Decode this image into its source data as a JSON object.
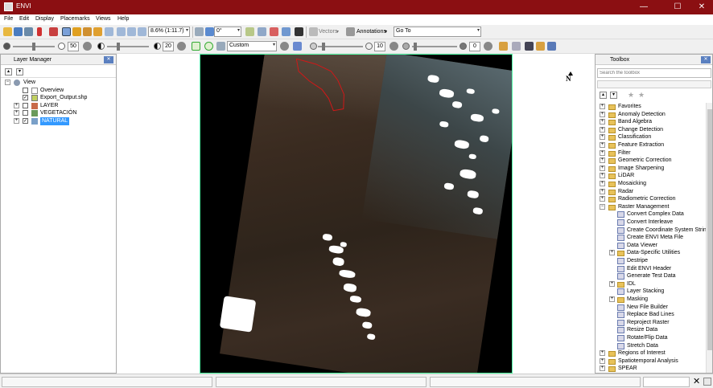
{
  "window": {
    "title": "ENVI",
    "minimize": "—",
    "maximize": "☐",
    "close": "✕"
  },
  "menu": [
    "File",
    "Edit",
    "Display",
    "Placemarks",
    "Views",
    "Help"
  ],
  "toolbar1": {
    "zoom_value": "8.6% (1:11.7)",
    "rotation_value": "0°",
    "vectors_label": "Vectors",
    "annotations_label": "Annotations",
    "goto_value": "Go To"
  },
  "toolbar2": {
    "brightness_value": "50",
    "contrast_value": "20",
    "stretch_value": "Custom",
    "sharpen_value": "10",
    "transparency_value": "0"
  },
  "layer_manager": {
    "title": "Layer Manager",
    "items": [
      {
        "label": "View"
      },
      {
        "label": "Overview"
      },
      {
        "label": "Export_Output.shp"
      },
      {
        "label": "LAYER"
      },
      {
        "label": "VEGETACIÓN"
      },
      {
        "label": "NATURAL"
      }
    ]
  },
  "north_arrow_label": "N",
  "toolbox": {
    "title": "Toolbox",
    "search_placeholder": "Search the toolbox",
    "items": [
      {
        "label": "Favorites",
        "kind": "folder"
      },
      {
        "label": "Anomaly Detection",
        "kind": "folder"
      },
      {
        "label": "Band Algebra",
        "kind": "folder"
      },
      {
        "label": "Change Detection",
        "kind": "folder"
      },
      {
        "label": "Classification",
        "kind": "folder"
      },
      {
        "label": "Feature Extraction",
        "kind": "folder"
      },
      {
        "label": "Filter",
        "kind": "folder"
      },
      {
        "label": "Geometric Correction",
        "kind": "folder"
      },
      {
        "label": "Image Sharpening",
        "kind": "folder"
      },
      {
        "label": "LiDAR",
        "kind": "folder"
      },
      {
        "label": "Mosaicking",
        "kind": "folder"
      },
      {
        "label": "Radar",
        "kind": "folder"
      },
      {
        "label": "Radiometric Correction",
        "kind": "folder"
      },
      {
        "label": "Raster Management",
        "kind": "folder-open"
      },
      {
        "label": "Convert Complex Data",
        "kind": "tool"
      },
      {
        "label": "Convert Interleave",
        "kind": "tool"
      },
      {
        "label": "Create Coordinate System String",
        "kind": "tool"
      },
      {
        "label": "Create ENVI Meta File",
        "kind": "tool"
      },
      {
        "label": "Data Viewer",
        "kind": "tool"
      },
      {
        "label": "Data-Specific Utilities",
        "kind": "subfolder"
      },
      {
        "label": "Destripe",
        "kind": "tool"
      },
      {
        "label": "Edit ENVI Header",
        "kind": "tool"
      },
      {
        "label": "Generate Test Data",
        "kind": "tool"
      },
      {
        "label": "IDL",
        "kind": "subfolder"
      },
      {
        "label": "Layer Stacking",
        "kind": "tool"
      },
      {
        "label": "Masking",
        "kind": "subfolder"
      },
      {
        "label": "New File Builder",
        "kind": "tool"
      },
      {
        "label": "Replace Bad Lines",
        "kind": "tool"
      },
      {
        "label": "Reproject Raster",
        "kind": "tool"
      },
      {
        "label": "Resize Data",
        "kind": "tool"
      },
      {
        "label": "Rotate/Flip Data",
        "kind": "tool"
      },
      {
        "label": "Stretch Data",
        "kind": "tool"
      },
      {
        "label": "Regions of Interest",
        "kind": "folder"
      },
      {
        "label": "Spatiotemporal Analysis",
        "kind": "folder"
      },
      {
        "label": "SPEAR",
        "kind": "folder"
      }
    ]
  },
  "colors": {
    "titlebar": "#8b0f12",
    "selection": "#3399ff",
    "aoi_outline": "#d01818"
  }
}
